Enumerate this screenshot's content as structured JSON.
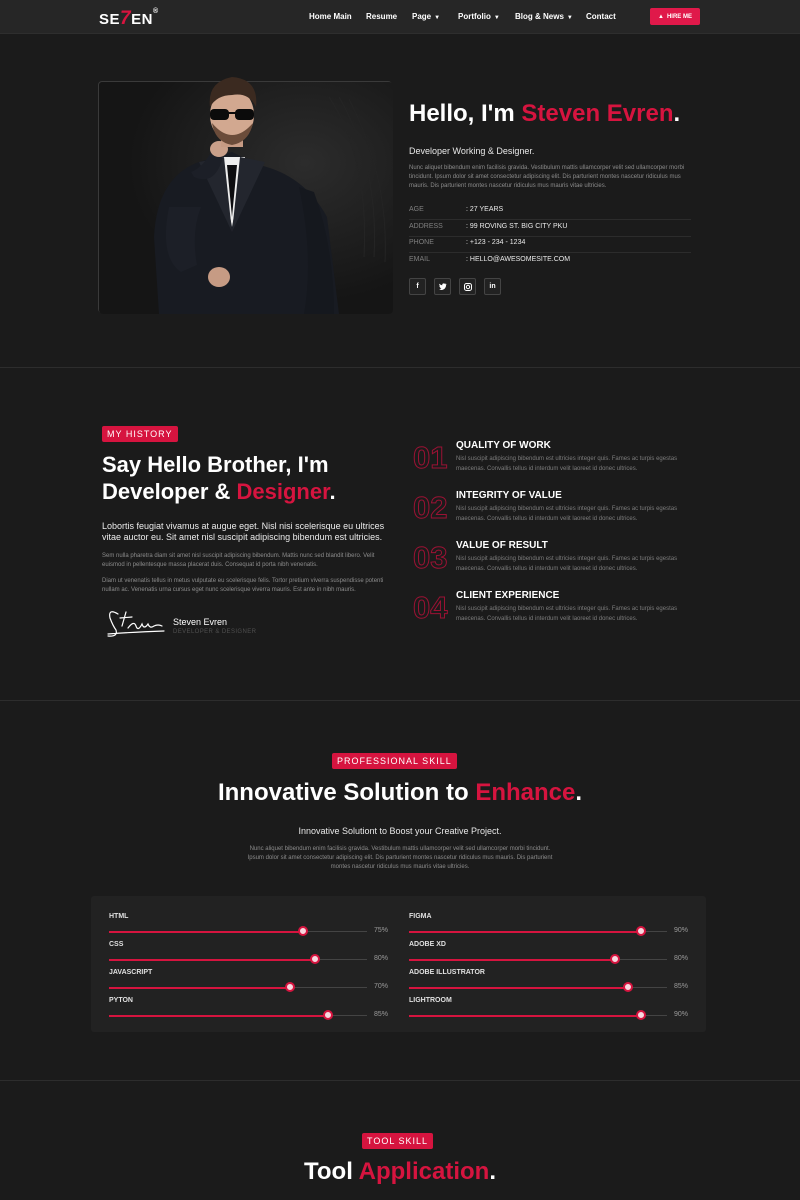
{
  "nav": {
    "logo": {
      "pre": "SE",
      "seven": "7",
      "post": "EN",
      "mark": "®"
    },
    "items": [
      {
        "label": "Home Main",
        "caret": false
      },
      {
        "label": "Resume",
        "caret": false
      },
      {
        "label": "Page",
        "caret": true
      },
      {
        "label": "Portfolio",
        "caret": true
      },
      {
        "label": "Blog & News",
        "caret": true
      },
      {
        "label": "Contact",
        "caret": false
      }
    ],
    "cta": "HIRE ME"
  },
  "hero": {
    "greeting": "Hello, I'm",
    "name": "Steven Evren",
    "dot": ".",
    "role": "Developer Working & Designer.",
    "body": "Nunc aliquet bibendum enim facilisis gravida. Vestibulum mattis ullamcorper velit sed ullamcorper morbi tincidunt. Ipsum dolor sit amet consectetur adipiscing elit. Dis parturient montes nascetur ridiculus mus mauris. Dis parturient montes nascetur ridiculus mus mauris vitae ultricies.",
    "info": [
      {
        "key": "AGE",
        "value": ": 27 YEARS"
      },
      {
        "key": "ADDRESS",
        "value": ": 99 ROVING ST. BIG CITY PKU"
      },
      {
        "key": "PHONE",
        "value": ": +123 - 234 - 1234"
      },
      {
        "key": "EMAIL",
        "value": ": HELLO@AWESOMESITE.COM"
      }
    ],
    "social": [
      "f",
      "t",
      "ig",
      "in"
    ]
  },
  "history": {
    "badge": "MY HISTORY",
    "title_line1": "Say Hello Brother, I'm",
    "title_line2_pre": "Developer &",
    "title_line2_accent": "Designer",
    "title_dot": ".",
    "lead": "Lobortis feugiat vivamus at augue eget. Nisl nisi scelerisque eu ultrices vitae auctor eu. Sit amet nisl suscipit adipiscing bibendum est ultricies.",
    "p1": "Sem nulla pharetra diam sit amet nisl suscipit adipiscing bibendum. Mattis nunc sed blandit libero. Velit euismod in pellentesque massa placerat duis. Consequat id porta nibh venenatis.",
    "p2": "Diam ut venenatis tellus in metus vulputate eu scelerisque felis. Tortor pretium viverra suspendisse potenti nullam ac. Venenatis urna cursus eget nunc scelerisque viverra mauris. Est ante in nibh mauris.",
    "signature": "Steven",
    "sign_name": "Steven Evren",
    "sign_role": "DEVELOPER & DESIGNER",
    "features": [
      {
        "num": "01",
        "title": "QUALITY OF WORK",
        "desc": "Nisl suscipit adipiscing bibendum est ultricies integer quis. Fames ac turpis egestas maecenas. Convallis tellus id interdum velit laoreet id donec ultrices."
      },
      {
        "num": "02",
        "title": "INTEGRITY OF VALUE",
        "desc": "Nisl suscipit adipiscing bibendum est ultricies integer quis. Fames ac turpis egestas maecenas. Convallis tellus id interdum velit laoreet id donec ultrices."
      },
      {
        "num": "03",
        "title": "VALUE OF RESULT",
        "desc": "Nisl suscipit adipiscing bibendum est ultricies integer quis. Fames ac turpis egestas maecenas. Convallis tellus id interdum velit laoreet id donec ultrices."
      },
      {
        "num": "04",
        "title": "CLIENT EXPERIENCE",
        "desc": "Nisl suscipit adipiscing bibendum est ultricies integer quis. Fames ac turpis egestas maecenas. Convallis tellus id interdum velit laoreet id donec ultrices."
      }
    ]
  },
  "skills": {
    "badge": "PROFESSIONAL SKILL",
    "title_pre": "Innovative Solution to",
    "title_accent": "Enhance",
    "title_dot": ".",
    "subtitle": "Innovative Solutiont to Boost your Creative Project.",
    "body": "Nunc aliquet bibendum enim facilisis gravida. Vestibulum mattis ullamcorper velit sed ullamcorper morbi tincidunt. Ipsum dolor sit amet consectetur adipiscing elit. Dis parturient montes nascetur ridiculus mus mauris. Dis parturient montes nascetur ridiculus mus mauris vitae ultricies.",
    "left": [
      {
        "label": "HTML",
        "value": 75,
        "pct": "75%"
      },
      {
        "label": "CSS",
        "value": 80,
        "pct": "80%"
      },
      {
        "label": "JAVASCRIPT",
        "value": 70,
        "pct": "70%"
      },
      {
        "label": "PYTON",
        "value": 85,
        "pct": "85%"
      }
    ],
    "right": [
      {
        "label": "FIGMA",
        "value": 90,
        "pct": "90%"
      },
      {
        "label": "ADOBE XD",
        "value": 80,
        "pct": "80%"
      },
      {
        "label": "ADOBE ILLUSTRATOR",
        "value": 85,
        "pct": "85%"
      },
      {
        "label": "LIGHTROOM",
        "value": 90,
        "pct": "90%"
      }
    ]
  },
  "tools": {
    "badge": "TOOL SKILL",
    "title_pre": "Tool",
    "title_accent": "Application",
    "title_dot": "."
  },
  "colors": {
    "accent": "#d6143f",
    "background": "#1b1b1b"
  }
}
